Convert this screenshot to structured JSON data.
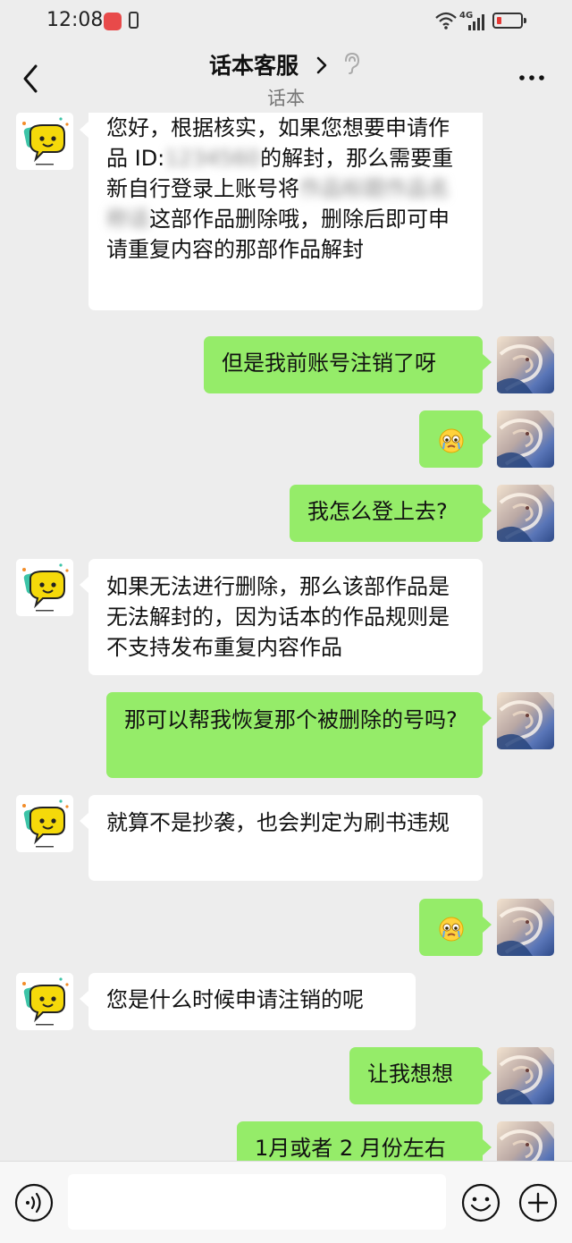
{
  "status_bar": {
    "time": "12:08",
    "network": "4G",
    "battery_level": 0.1
  },
  "header": {
    "title": "话本客服",
    "subtitle": "话本"
  },
  "icons": {
    "back": "chevron-left-icon",
    "title_arrow": "chevron-right-icon",
    "ear": "ear-icon",
    "more": "more-dots-icon",
    "voice": "voice-icon",
    "emoji": "emoji-icon",
    "plus": "plus-icon"
  },
  "colors": {
    "background": "#ededed",
    "sent_bubble": "#95ec69",
    "received_bubble": "#ffffff",
    "bot_avatar_accent": "#f5d90a"
  },
  "messages": [
    {
      "from": "bot",
      "parts": [
        "您好，根据核实，如果您想要申请作品 ID:",
        "1234560",
        "的解封，那么需要重新自行登录上账号将",
        "作品标题作品名称话",
        "这部作品删除哦，删除后即可申请重复内容的那部作品解封"
      ]
    },
    {
      "from": "me",
      "text": "但是我前账号注销了呀"
    },
    {
      "from": "me",
      "emoji": "crying-face-icon"
    },
    {
      "from": "me",
      "text": "我怎么登上去?"
    },
    {
      "from": "bot",
      "text": "如果无法进行删除，那么该部作品是无法解封的，因为话本的作品规则是不支持发布重复内容作品"
    },
    {
      "from": "me",
      "text": "那可以帮我恢复那个被删除的号吗?"
    },
    {
      "from": "bot",
      "text": "就算不是抄袭，也会判定为刷书违规"
    },
    {
      "from": "me",
      "emoji": "crying-face-icon"
    },
    {
      "from": "bot",
      "text": "您是什么时候申请注销的呢"
    },
    {
      "from": "me",
      "text": "让我想想"
    },
    {
      "from": "me",
      "text": "1月或者 2 月份左右"
    }
  ],
  "input": {
    "value": "",
    "placeholder": ""
  }
}
